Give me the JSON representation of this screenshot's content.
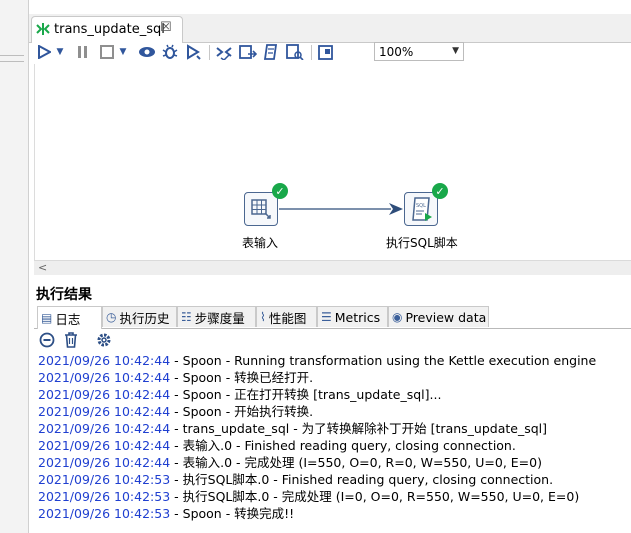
{
  "editor_tab": {
    "title": "trans_update_sql",
    "close_glyph": "☒"
  },
  "toolbar": {
    "zoom": "100%",
    "icons": [
      "run-icon",
      "run-dropdown-icon",
      "pause-icon",
      "stop-icon",
      "preview-icon",
      "debug-icon",
      "replay-icon",
      "verify-icon",
      "impact-icon",
      "sql-icon",
      "explore-db-icon",
      "show-results-icon"
    ]
  },
  "canvas": {
    "steps": [
      {
        "label": "表输入",
        "icon": "table-input-icon"
      },
      {
        "label": "执行SQL脚本",
        "icon": "sql-script-icon"
      }
    ]
  },
  "results": {
    "title": "执行结果",
    "tabs": [
      {
        "label": "日志",
        "icon": "log-icon"
      },
      {
        "label": "执行历史",
        "icon": "history-icon"
      },
      {
        "label": "步骤度量",
        "icon": "step-metrics-icon"
      },
      {
        "label": "性能图",
        "icon": "performance-graph-icon"
      },
      {
        "label": "Metrics",
        "icon": "metrics-icon"
      },
      {
        "label": "Preview data",
        "icon": "preview-data-icon"
      }
    ],
    "log_lines": [
      {
        "ts": "2021/09/26 10:42:44",
        "msg": " - Spoon - Running transformation using the Kettle execution engine"
      },
      {
        "ts": "2021/09/26 10:42:44",
        "msg": " - Spoon - 转换已经打开."
      },
      {
        "ts": "2021/09/26 10:42:44",
        "msg": " - Spoon - 正在打开转换 [trans_update_sql]..."
      },
      {
        "ts": "2021/09/26 10:42:44",
        "msg": " - Spoon - 开始执行转换."
      },
      {
        "ts": "2021/09/26 10:42:44",
        "msg": " - trans_update_sql - 为了转换解除补丁开始  [trans_update_sql]"
      },
      {
        "ts": "2021/09/26 10:42:44",
        "msg": " - 表输入.0 - Finished reading query, closing connection."
      },
      {
        "ts": "2021/09/26 10:42:44",
        "msg": " - 表输入.0 - 完成处理 (I=550, O=0, R=0, W=550, U=0, E=0)"
      },
      {
        "ts": "2021/09/26 10:42:53",
        "msg": " - 执行SQL脚本.0 - Finished reading query, closing connection."
      },
      {
        "ts": "2021/09/26 10:42:53",
        "msg": " - 执行SQL脚本.0 - 完成处理 (I=0, O=0, R=550, W=550, U=0, E=0)"
      },
      {
        "ts": "2021/09/26 10:42:53",
        "msg": " - Spoon - 转换完成!!"
      }
    ]
  },
  "colors": {
    "accent": "#30569c",
    "timestamp": "#1f3fd0",
    "success": "#19a84a"
  }
}
